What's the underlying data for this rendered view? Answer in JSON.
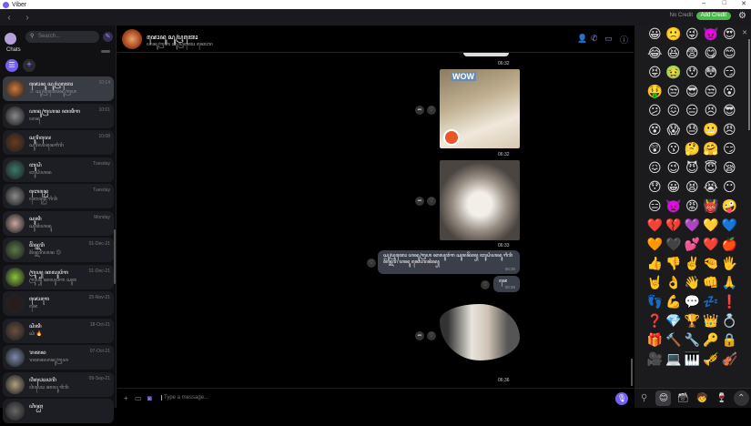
{
  "window": {
    "title": "Viber",
    "min": "–",
    "max": "□",
    "close": "✕"
  },
  "nav": {
    "back": "‹",
    "forward": "›",
    "credit": "No Credit",
    "add_credit": "Add Credit"
  },
  "sidebar": {
    "search_placeholder": "Search...",
    "chats_label": "Chats",
    "chats": [
      {
        "name": "ꦗꦺꦴꦤꦸ ꦱꦸꦥꦿꦠꦺꦴ",
        "preview": "☺ ꦱꦸꦥꦿꦠꦺꦴꦤꦸꦒꦿꦲ",
        "time": "10:14",
        "color": "#d27a3a"
      },
      {
        "name": "ꦲꦤꦸꦒꦿꦲꦤ ꦏꦠꦶꦒ",
        "preview": "ꦲꦤꦸ",
        "time": "10:01",
        "color": "#888888"
      },
      {
        "name": "ꦱꦸꦫꦶꦪꦺ",
        "preview": "ꦱꦸꦫꦶꦪꦤꦺꦒꦶꦫꦶ",
        "time": "10:08",
        "color": "#6a3a20"
      },
      {
        "name": "ꦧꦸꦝꦶ",
        "preview": "ꦧꦸꦝꦶꦲꦤ",
        "time": "Tuesday",
        "color": "#3c7a6a"
      },
      {
        "name": "ꦧꦺꦤ꧀ꦝꦺ",
        "preview": "ꦧꦺꦤ꧀ꦝꦺ ꦒꦶꦫꦶ",
        "time": "Tuesday",
        "color": "#8a8a8a"
      },
      {
        "name": "ꦱꦸꦠꦶ",
        "preview": "ꦱꦸꦠꦶꦲꦤꦸ",
        "time": "Monday",
        "color": "#c9a9a0"
      },
      {
        "name": "ꦩꦼꦤ꧀ꦠꦫꦶ",
        "preview": "ꦩꦼꦤ꧀ꦠꦫꦶꦲꦤ 😊",
        "time": "01-Dec-21",
        "color": "#5a7a4a"
      },
      {
        "name": "ꦒꦿꦸꦥ꧀ ꦏꦭꦸꦮꦂꦒ",
        "preview": "ꦒꦿꦸꦥ꧀ ꦏꦭꦸꦮꦂꦒ ꦱꦸꦩ",
        "time": "01-Dec-21",
        "color": "#8ac43a"
      },
      {
        "name": "ꦗꦺꦴꦒꦺ",
        "preview": "ꦗꦺ",
        "time": "25-Nov-21",
        "color": "#2a1a1a"
      },
      {
        "name": "ꦱꦶꦠꦶ",
        "preview": "ꦱꦶ 🔥",
        "time": "18-Oct-21",
        "color": "#6a5040"
      },
      {
        "name": "ꦫꦠꦤ",
        "preview": "ꦫꦠꦤꦲꦤꦸꦒꦿꦲ",
        "time": "07-Oct-21",
        "color": "#7a8ab0"
      },
      {
        "name": "ꦮꦶꦣꦺꦴꦣꦫꦶ",
        "preview": "ꦮꦶꦣꦺꦴ ꦏꦭꦸ ꦒꦶꦫꦶ",
        "time": "09-Sep-21",
        "color": "#b0a080"
      },
      {
        "name": "ꦲꦶꦤ꧀ꦝꦃ",
        "preview": "",
        "time": "",
        "color": "#666"
      }
    ]
  },
  "chat": {
    "title": "ꦗꦺꦴꦤꦸ ꦱꦸꦥꦿꦠꦺꦴ",
    "subtitle": "ꦲꦤꦸꦒꦿꦲ ꦱꦸꦥꦿꦠꦺꦴ ꦏꦺꦴꦫ",
    "image_caption": "WOW",
    "times": [
      "06:32",
      "06:32",
      "06:33",
      "06:36"
    ],
    "message1": "ꦱꦸꦥꦿꦠꦺꦴ ꦲꦤꦸꦒꦿꦲ ꦏꦭꦸꦮꦂꦒ ꦱꦸꦩꦤꦼꦩ꧀ ꦧꦸꦝꦶꦲꦤꦸ ꦒꦶꦫꦶ ꦩꦼꦤ꧀ꦠꦫꦶ ꦲꦤꦸ ꦏꦺꦴꦫꦤꦶꦤ꧀",
    "message1_time": "06:35",
    "message2": "ꦗꦺ",
    "message2_time": "06:35",
    "input_placeholder": "Type a message..."
  },
  "emoji": {
    "items": [
      "😀",
      "🙁",
      "😜",
      "👿",
      "😍",
      "😂",
      "😆",
      "😨",
      "😋",
      "😊",
      "😝",
      "🤢",
      "😯",
      "😳",
      "😏",
      "🤑",
      "😒",
      "😎",
      "😒",
      "😮",
      "😕",
      "😖",
      "😑",
      "😣",
      "😎",
      "😵",
      "😱",
      "😓",
      "😬",
      "😠",
      "😲",
      "😗",
      "🤔",
      "🤗",
      "😏",
      "😖",
      "😉",
      "😈",
      "😇",
      "😪",
      "😯",
      "😀",
      "😫",
      "😭",
      "😶",
      "😑",
      "👿",
      "😡",
      "👹",
      "🤪",
      "❤️",
      "💔",
      "💜",
      "💛",
      "💙",
      "🧡",
      "🖤",
      "💕",
      "❤️",
      "🍎",
      "👍",
      "👎",
      "✌️",
      "🤏",
      "🖐",
      "🤘",
      "👌",
      "👋",
      "👊",
      "🙏",
      "👣",
      "💪",
      "💬",
      "💤",
      "❗",
      "❓",
      "💎",
      "🏆",
      "👑",
      "💍",
      "🎁",
      "🔨",
      "🔧",
      "🔑",
      "🔒",
      "🎥",
      "💻",
      "🎹",
      "🎺",
      "🎻"
    ]
  }
}
